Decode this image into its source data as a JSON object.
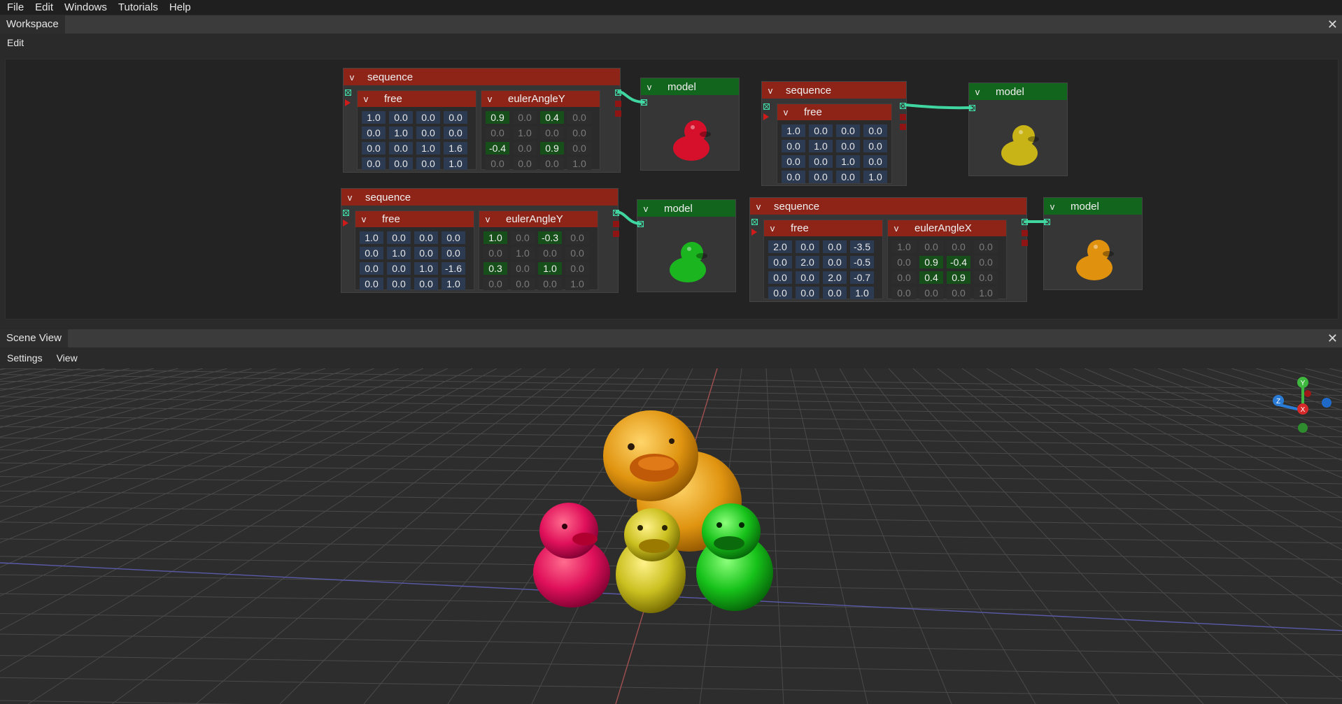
{
  "menu": [
    "File",
    "Edit",
    "Windows",
    "Tutorials",
    "Help"
  ],
  "workspace": {
    "title": "Workspace",
    "toolbar": [
      "Edit"
    ],
    "close_icon": "close-icon",
    "nodes": {
      "seq1": {
        "title": "sequence",
        "toggle": "v",
        "free": {
          "title": "free",
          "toggle": "v",
          "matrix": [
            [
              "1.0",
              "0.0",
              "0.0",
              "0.0"
            ],
            [
              "0.0",
              "1.0",
              "0.0",
              "0.0"
            ],
            [
              "0.0",
              "0.0",
              "1.0",
              "1.6"
            ],
            [
              "0.0",
              "0.0",
              "0.0",
              "1.0"
            ]
          ]
        },
        "euler": {
          "title": "eulerAngleY",
          "toggle": "v",
          "matrix": [
            [
              "0.9",
              "0.0",
              "0.4",
              "0.0"
            ],
            [
              "0.0",
              "1.0",
              "0.0",
              "0.0"
            ],
            [
              "-0.4",
              "0.0",
              "0.9",
              "0.0"
            ],
            [
              "0.0",
              "0.0",
              "0.0",
              "1.0"
            ]
          ]
        }
      },
      "model1": {
        "title": "model",
        "toggle": "v",
        "duck_color": "#d6102a"
      },
      "seq2": {
        "title": "sequence",
        "toggle": "v",
        "free": {
          "title": "free",
          "toggle": "v",
          "matrix": [
            [
              "1.0",
              "0.0",
              "0.0",
              "0.0"
            ],
            [
              "0.0",
              "1.0",
              "0.0",
              "0.0"
            ],
            [
              "0.0",
              "0.0",
              "1.0",
              "0.0"
            ],
            [
              "0.0",
              "0.0",
              "0.0",
              "1.0"
            ]
          ]
        }
      },
      "model2": {
        "title": "model",
        "toggle": "v",
        "duck_color": "#c9b418"
      },
      "seq3": {
        "title": "sequence",
        "toggle": "v",
        "free": {
          "title": "free",
          "toggle": "v",
          "matrix": [
            [
              "1.0",
              "0.0",
              "0.0",
              "0.0"
            ],
            [
              "0.0",
              "1.0",
              "0.0",
              "0.0"
            ],
            [
              "0.0",
              "0.0",
              "1.0",
              "-1.6"
            ],
            [
              "0.0",
              "0.0",
              "0.0",
              "1.0"
            ]
          ]
        },
        "euler": {
          "title": "eulerAngleY",
          "toggle": "v",
          "matrix": [
            [
              "1.0",
              "0.0",
              "-0.3",
              "0.0"
            ],
            [
              "0.0",
              "1.0",
              "0.0",
              "0.0"
            ],
            [
              "0.3",
              "0.0",
              "1.0",
              "0.0"
            ],
            [
              "0.0",
              "0.0",
              "0.0",
              "1.0"
            ]
          ]
        }
      },
      "model3": {
        "title": "model",
        "toggle": "v",
        "duck_color": "#1bb51f"
      },
      "seq4": {
        "title": "sequence",
        "toggle": "v",
        "free": {
          "title": "free",
          "toggle": "v",
          "matrix": [
            [
              "2.0",
              "0.0",
              "0.0",
              "-3.5"
            ],
            [
              "0.0",
              "2.0",
              "0.0",
              "-0.5"
            ],
            [
              "0.0",
              "0.0",
              "2.0",
              "-0.7"
            ],
            [
              "0.0",
              "0.0",
              "0.0",
              "1.0"
            ]
          ]
        },
        "euler": {
          "title": "eulerAngleX",
          "toggle": "v",
          "matrix": [
            [
              "1.0",
              "0.0",
              "0.0",
              "0.0"
            ],
            [
              "0.0",
              "0.9",
              "-0.4",
              "0.0"
            ],
            [
              "0.0",
              "0.4",
              "0.9",
              "0.0"
            ],
            [
              "0.0",
              "0.0",
              "0.0",
              "1.0"
            ]
          ]
        }
      },
      "model4": {
        "title": "model",
        "toggle": "v",
        "duck_color": "#e0920f"
      }
    }
  },
  "scene": {
    "title": "Scene View",
    "toolbar": [
      "Settings",
      "View"
    ],
    "gizmo": {
      "y": "Y",
      "z": "Z",
      "x": "X"
    },
    "colors": {
      "axis_y": "#3fb83f",
      "axis_z": "#2a7bd6",
      "axis_x": "#d62a2a",
      "grid": "#4a4a4a"
    }
  }
}
